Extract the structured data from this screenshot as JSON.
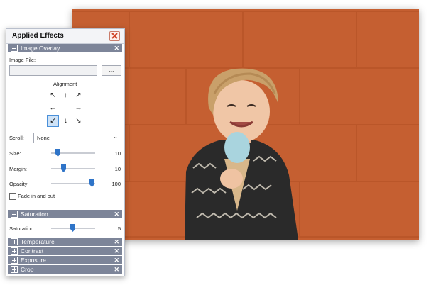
{
  "panel": {
    "title": "Applied Effects",
    "sections": {
      "image_overlay": {
        "header": "Image Overlay",
        "image_file_label": "Image File:",
        "image_file_value": "",
        "browse_label": "...",
        "alignment_label": "Alignment",
        "alignment_arrows": [
          "↖",
          "↑",
          "↗",
          "←",
          "",
          "→",
          "↙",
          "↓",
          "↘"
        ],
        "alignment_selected": "bottom-left",
        "scroll_label": "Scroll:",
        "scroll_value": "None",
        "size_label": "Size:",
        "size_value": "10",
        "margin_label": "Margin:",
        "margin_value": "10",
        "opacity_label": "Opacity:",
        "opacity_value": "100",
        "fade_label": "Fade in and out",
        "fade_checked": false
      },
      "saturation": {
        "header": "Saturation",
        "saturation_label": "Saturation:",
        "saturation_value": "5"
      },
      "collapsed": [
        "Temperature",
        "Contrast",
        "Exposure",
        "Crop"
      ]
    }
  },
  "colors": {
    "section_header": "#7d8599",
    "accent": "#2f74c8",
    "photo_wall": "#c65f31"
  },
  "icons": {
    "close": "close-icon",
    "collapse": "minus-icon",
    "expand": "plus-icon",
    "remove": "x-icon",
    "dropdown": "chevron-down-icon"
  }
}
